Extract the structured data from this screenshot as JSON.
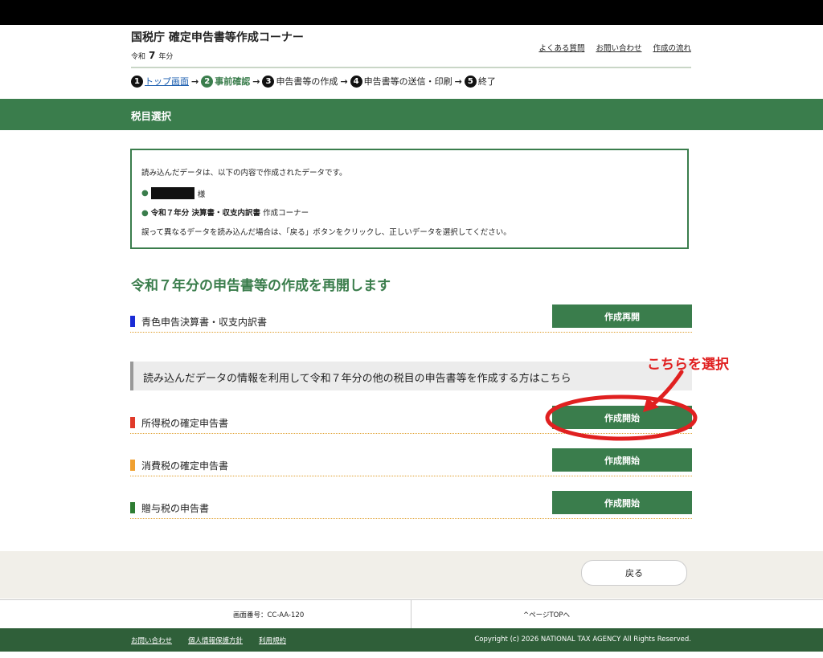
{
  "header": {
    "title": "国税庁 確定申告書等作成コーナー",
    "year_prefix": "令和",
    "year_num": "7",
    "year_suffix": "年分",
    "links": [
      "よくある質問",
      "お問い合わせ",
      "作成の流れ"
    ]
  },
  "steps": [
    {
      "num": "1",
      "label": "トップ画面"
    },
    {
      "num": "2",
      "label": "事前確認"
    },
    {
      "num": "3",
      "label": "申告書等の作成"
    },
    {
      "num": "4",
      "label": "申告書等の送信・印刷"
    },
    {
      "num": "5",
      "label": "終了"
    }
  ],
  "step_arrow": "→",
  "section_title": "税目選択",
  "info_box": {
    "line1": "読み込んだデータは、以下の内容で作成されたデータです。",
    "bullet1_suffix": "様",
    "bullet2_bold": "令和７年分 決算書・収支内訳書",
    "bullet2_rest": " 作成コーナー",
    "note": "誤って異なるデータを読み込んだ場合は、「戻る」ボタンをクリックし、正しいデータを選択してください。"
  },
  "resume": {
    "heading": "令和７年分の申告書等の作成を再開します",
    "item": {
      "label": "青色申告決算書・収支内訳書",
      "button": "作成再開",
      "color": "#1a2bd6"
    }
  },
  "other": {
    "band_text": "読み込んだデータの情報を利用して令和７年分の他の税目の申告書等を作成する方はこちら",
    "items": [
      {
        "label": "所得税の確定申告書",
        "button": "作成開始",
        "color": "#e03a2a"
      },
      {
        "label": "消費税の確定申告書",
        "button": "作成開始",
        "color": "#f0a030"
      },
      {
        "label": "贈与税の申告書",
        "button": "作成開始",
        "color": "#2e7d32"
      }
    ]
  },
  "annotation": {
    "text": "こちらを選択",
    "color": "#e02020"
  },
  "back_button": "戻る",
  "footer": {
    "screen_no": "画面番号：CC-AA-120",
    "pagetop": "ページTOPへ",
    "links": [
      "お問い合わせ",
      "個人情報保護方針",
      "利用規約"
    ],
    "copyright": "Copyright (c) 2026 NATIONAL TAX AGENCY All Rights Reserved."
  },
  "colors": {
    "brand_green": "#3a7d4c",
    "footer_green": "#2f5f39"
  }
}
